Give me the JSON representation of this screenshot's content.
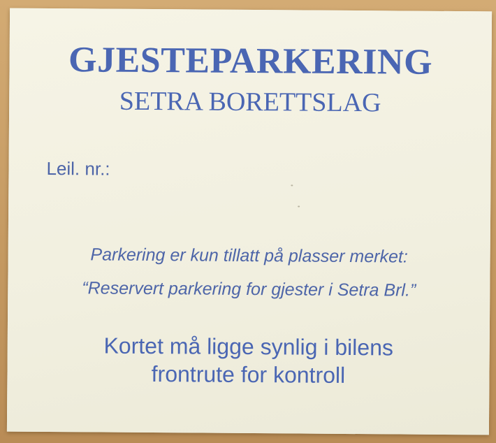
{
  "sign": {
    "title": "GJESTEPARKERING",
    "subtitle": "SETRA BORETTSLAG",
    "unit_label": "Leil. nr.:",
    "rules": [
      "Parkering er kun tillatt på plasser merket:",
      "“Reservert parkering for gjester i Setra Brl.”"
    ],
    "notice_lines": [
      "Kortet må ligge synlig i bilens",
      "frontrute for kontroll"
    ]
  },
  "colors": {
    "ink": "#4a66b3",
    "card": "#f4f2e3",
    "wood": "#c9a06a"
  }
}
